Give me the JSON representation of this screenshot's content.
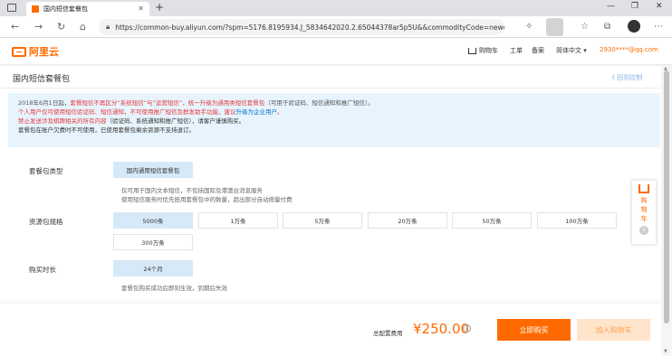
{
  "browser": {
    "tab_title": "国内短信套餐包",
    "tab_close": "✕",
    "new_tab": "+",
    "url": "https://common-buy.aliyun.com/?spm=5176.8195934.J_5834642020.2.65044378ar5p5U&&commodityCode=newdysms...",
    "window_controls": [
      "—",
      "❐",
      "✕"
    ]
  },
  "header": {
    "logo_text": "阿里云",
    "nav": {
      "cart": "购物车",
      "ticket": "工单",
      "beian": "备案",
      "lang": "简体中文 ▾"
    },
    "email": "2930****@qq.com"
  },
  "page": {
    "title": "国内短信套餐包",
    "back_link": "《 回到控制",
    "notice": {
      "line1_a": "2018年6月1日起，",
      "line1_b": "套餐短信不再区分“系统短信”与“运营短信”，统一升级为通用类短信套餐包",
      "line1_c": "（可用于验证码、短信通知和推广短信）。",
      "line2_a": "个人用户仅可使用短信验证码、短信通知，不可使用推广短信及群发助手功能，建议",
      "line2_b": "升级为企业用户",
      "line2_c": "。",
      "line3_a": "禁止发送涉及棋牌相关的所有内容",
      "line3_b": "（验证码、系统通知和推广短信），请客户谨慎购买。",
      "line4": "套餐包在账户欠费时不可使用，已使用套餐包剩余资源不支持退订。"
    },
    "side_cart": {
      "line1": "购",
      "line2": "物",
      "line3": "车",
      "dot": "0"
    }
  },
  "form": {
    "package_type": {
      "label": "套餐包类型",
      "selected": "国内通用短信套餐包",
      "desc1": "仅可用于国内文本短信，不包括国际及港澳台消息服务",
      "desc2": "使用短信服务时优先抵用套餐包中的数量，超出部分自动按量付费"
    },
    "spec": {
      "label": "资源包规格",
      "options": [
        "5000条",
        "1万条",
        "5万条",
        "20万条",
        "50万条",
        "100万条",
        "300万条"
      ]
    },
    "duration": {
      "label": "购买时长",
      "selected": "24个月",
      "desc": "套餐包购买成功后即刻生效，到期后失效"
    }
  },
  "footer": {
    "total_label": "总配置费用",
    "price": "¥250.00",
    "help": "?",
    "buy_button": "立即购买",
    "cart_button": "加入购物车"
  }
}
